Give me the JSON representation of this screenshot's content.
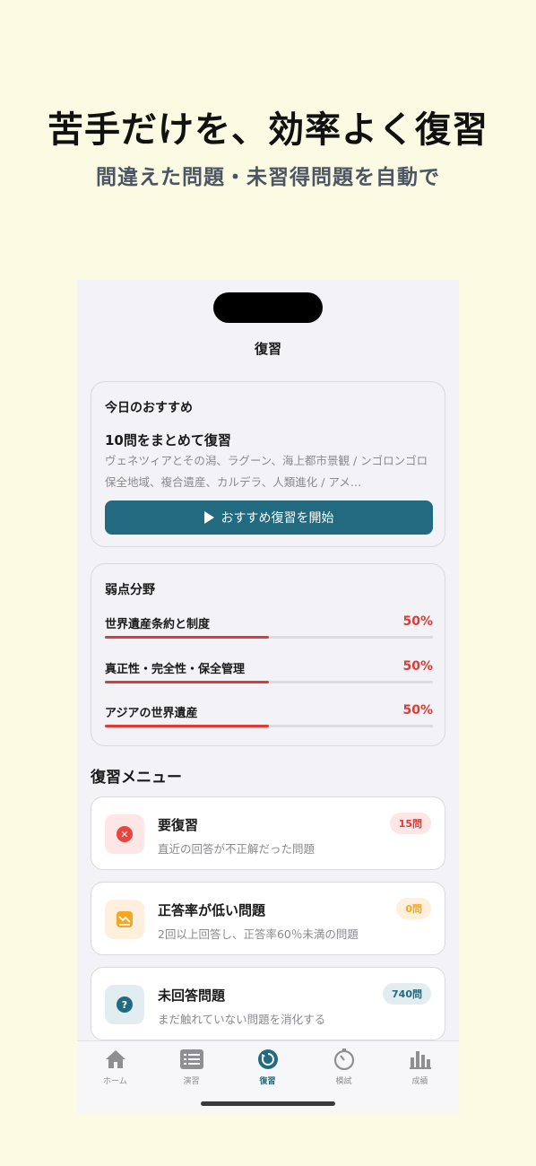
{
  "promo": {
    "headline": "苦手だけを、効率よく復習",
    "subline": "間違えた問題・未習得問題を自動で"
  },
  "screen": {
    "nav_title": "復習",
    "recommend": {
      "heading": "今日のおすすめ",
      "title": "10問をまとめて復習",
      "description": "ヴェネツィアとその潟、ラグーン、海上都市景観 / ンゴロンゴロ保全地域、複合遺産、カルデラ、人類進化 / アメ…",
      "button_label": "おすすめ復習を開始",
      "button_color": "#226a80"
    },
    "weak": {
      "heading": "弱点分野",
      "items": [
        {
          "label": "世界遺産条約と制度",
          "percent_text": "50%",
          "value": 0.5
        },
        {
          "label": "真正性・完全性・保全管理",
          "percent_text": "50%",
          "value": 0.5
        },
        {
          "label": "アジアの世界遺産",
          "percent_text": "50%",
          "value": 0.5
        }
      ],
      "accent_color": "#e03a34"
    },
    "menu_section_title": "復習メニュー",
    "menu": [
      {
        "title": "要復習",
        "description": "直近の回答が不正解だった問題",
        "badge": "15問",
        "icon": "x-circle-icon",
        "icon_color": "#e8453c",
        "icon_bg": "#fde6e5",
        "badge_color": "#e03a34",
        "badge_bg": "#fde6e5"
      },
      {
        "title": "正答率が低い問題",
        "description": "2回以上回答し、正答率60％未満の問題",
        "badge": "0問",
        "icon": "chart-down-icon",
        "icon_color": "#f5a623",
        "icon_bg": "#fef0dc",
        "badge_color": "#f5a623",
        "badge_bg": "#fef0dc"
      },
      {
        "title": "未回答問題",
        "description": "まだ触れていない問題を消化する",
        "badge": "740問",
        "icon": "question-circle-icon",
        "icon_color": "#226a80",
        "icon_bg": "#e1edf0",
        "badge_color": "#226a80",
        "badge_bg": "#e1edf0"
      }
    ],
    "tabs": [
      {
        "label": "ホーム",
        "icon": "home-icon"
      },
      {
        "label": "演習",
        "icon": "list-icon"
      },
      {
        "label": "復習",
        "icon": "review-icon",
        "active": true
      },
      {
        "label": "模試",
        "icon": "timer-icon"
      },
      {
        "label": "成績",
        "icon": "bar-chart-icon"
      }
    ]
  }
}
